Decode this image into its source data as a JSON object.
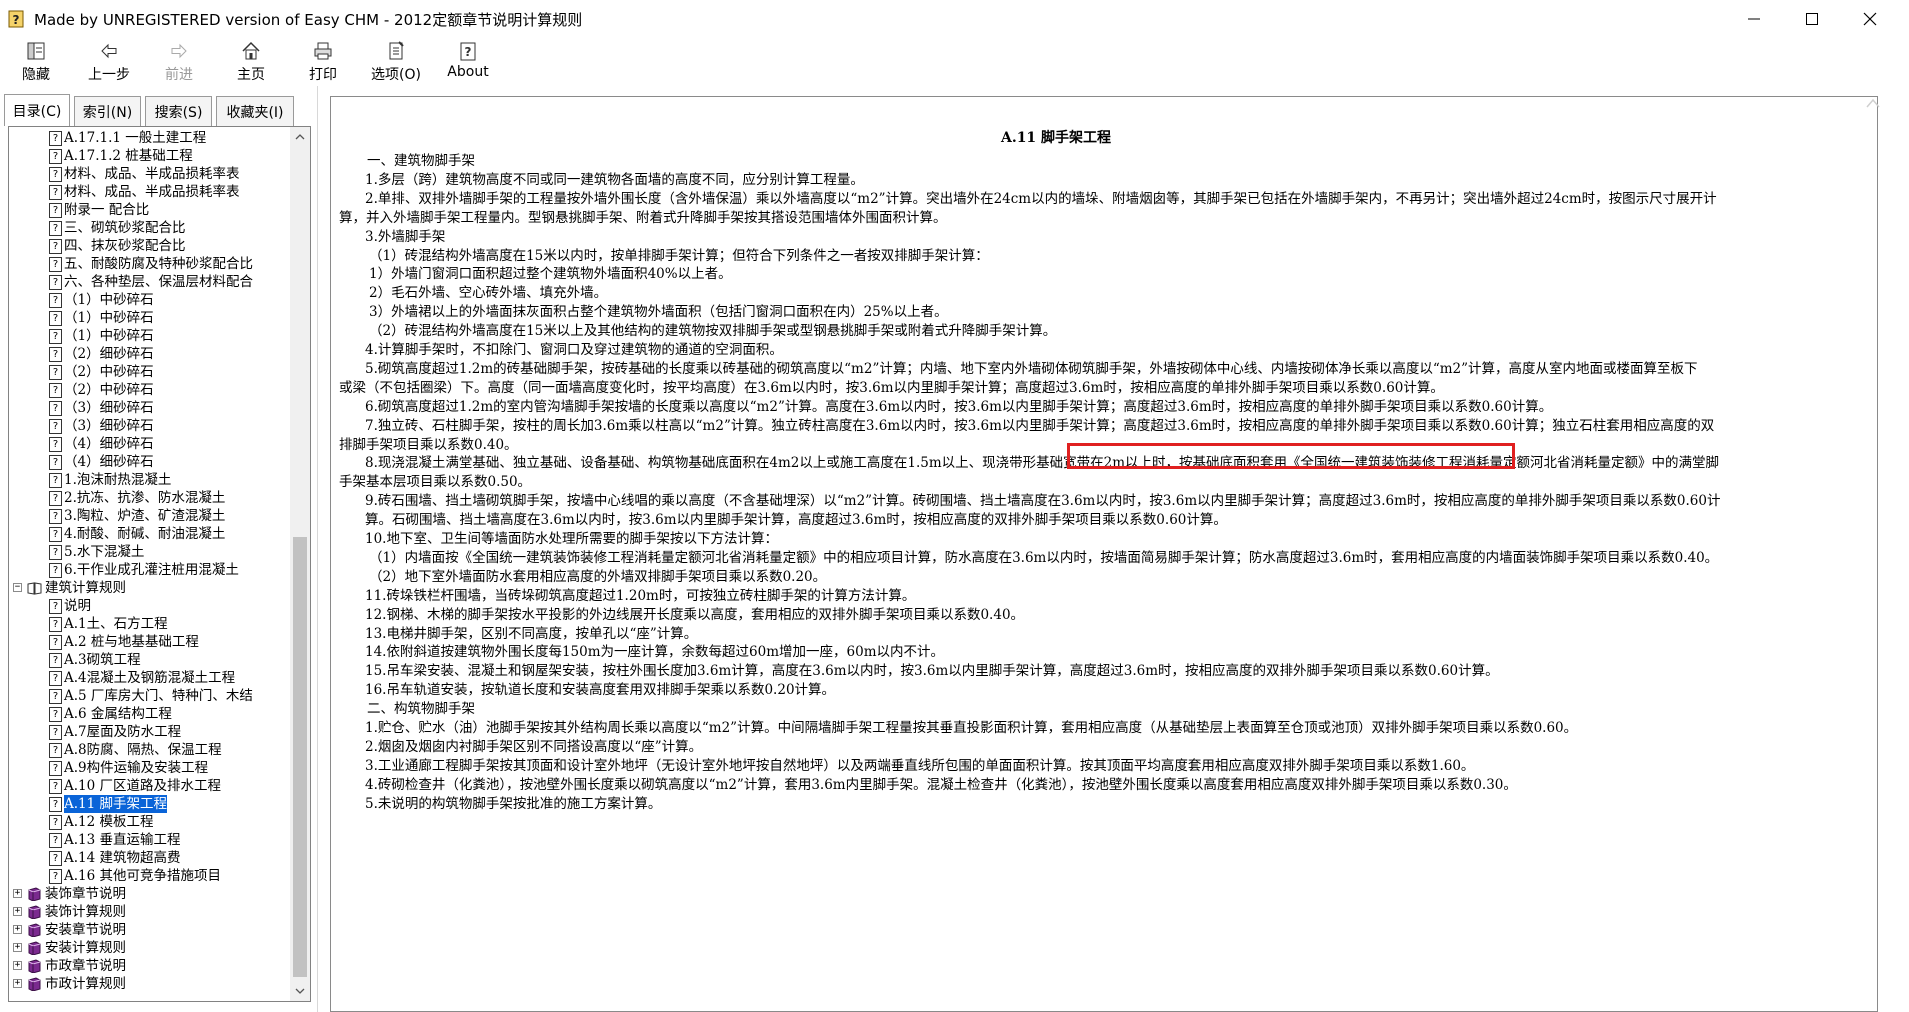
{
  "window": {
    "title": "Made by UNREGISTERED version of Easy CHM - 2012定额章节说明计算规则"
  },
  "toolbar": {
    "hide": "隐藏",
    "back": "上一步",
    "forward": "前进",
    "home": "主页",
    "print": "打印",
    "options": "选项(O)",
    "about": "About"
  },
  "nav_tabs": {
    "contents": "目录(C)",
    "index": "索引(N)",
    "search": "搜索(S)",
    "favorites": "收藏夹(I)"
  },
  "tree": [
    {
      "label": "A.17.1.1 一般土建工程",
      "type": "topic",
      "level": 3
    },
    {
      "label": "A.17.1.2 桩基础工程",
      "type": "topic",
      "level": 3
    },
    {
      "label": "材料、成品、半成品损耗率表",
      "type": "topic",
      "level": 3
    },
    {
      "label": "材料、成品、半成品损耗率表",
      "type": "topic",
      "level": 3
    },
    {
      "label": "附录一 配合比",
      "type": "topic",
      "level": 3
    },
    {
      "label": "三、砌筑砂浆配合比",
      "type": "topic",
      "level": 3
    },
    {
      "label": "四、抹灰砂浆配合比",
      "type": "topic",
      "level": 3
    },
    {
      "label": "五、耐酸防腐及特种砂浆配合比",
      "type": "topic",
      "level": 3
    },
    {
      "label": "六、各种垫层、保温层材料配合",
      "type": "topic",
      "level": 3
    },
    {
      "label": "（1）中砂碎石",
      "type": "topic",
      "level": 3
    },
    {
      "label": "（1）中砂碎石",
      "type": "topic",
      "level": 3
    },
    {
      "label": "（1）中砂碎石",
      "type": "topic",
      "level": 3
    },
    {
      "label": "（2）细砂碎石",
      "type": "topic",
      "level": 3
    },
    {
      "label": "（2）中砂碎石",
      "type": "topic",
      "level": 3
    },
    {
      "label": "（2）中砂碎石",
      "type": "topic",
      "level": 3
    },
    {
      "label": "（3）细砂碎石",
      "type": "topic",
      "level": 3
    },
    {
      "label": "（3）细砂碎石",
      "type": "topic",
      "level": 3
    },
    {
      "label": "（4）细砂碎石",
      "type": "topic",
      "level": 3
    },
    {
      "label": "（4）细砂碎石",
      "type": "topic",
      "level": 3
    },
    {
      "label": "1.泡沫耐热混凝土",
      "type": "topic",
      "level": 3
    },
    {
      "label": "2.抗冻、抗渗、防水混凝土",
      "type": "topic",
      "level": 3
    },
    {
      "label": "3.陶粒、炉渣、矿渣混凝土",
      "type": "topic",
      "level": 3
    },
    {
      "label": "4.耐酸、耐碱、耐油混凝土",
      "type": "topic",
      "level": 3
    },
    {
      "label": "5.水下混凝土",
      "type": "topic",
      "level": 3
    },
    {
      "label": "6.干作业成孔灌注桩用混凝土",
      "type": "topic",
      "level": 3
    },
    {
      "label": "建筑计算规则",
      "type": "book-open",
      "level": 1,
      "expander": "−"
    },
    {
      "label": "说明",
      "type": "topic",
      "level": 3
    },
    {
      "label": "A.1土、石方工程",
      "type": "topic",
      "level": 3
    },
    {
      "label": "A.2 桩与地基基础工程",
      "type": "topic",
      "level": 3
    },
    {
      "label": "A.3砌筑工程",
      "type": "topic",
      "level": 3
    },
    {
      "label": "A.4混凝土及钢筋混凝土工程",
      "type": "topic",
      "level": 3
    },
    {
      "label": "A.5 厂库房大门、特种门、木结",
      "type": "topic",
      "level": 3
    },
    {
      "label": "A.6 金属结构工程",
      "type": "topic",
      "level": 3
    },
    {
      "label": "A.7屋面及防水工程",
      "type": "topic",
      "level": 3
    },
    {
      "label": "A.8防腐、隔热、保温工程",
      "type": "topic",
      "level": 3
    },
    {
      "label": "A.9构件运输及安装工程",
      "type": "topic",
      "level": 3
    },
    {
      "label": "A.10 厂区道路及排水工程",
      "type": "topic",
      "level": 3
    },
    {
      "label": "A.11 脚手架工程",
      "type": "topic",
      "level": 3,
      "selected": true
    },
    {
      "label": "A.12 模板工程",
      "type": "topic",
      "level": 3
    },
    {
      "label": "A.13 垂直运输工程",
      "type": "topic",
      "level": 3
    },
    {
      "label": "A.14 建筑物超高费",
      "type": "topic",
      "level": 3
    },
    {
      "label": "A.16 其他可竞争措施项目",
      "type": "topic",
      "level": 3
    },
    {
      "label": "装饰章节说明",
      "type": "book",
      "level": 1,
      "expander": "+"
    },
    {
      "label": "装饰计算规则",
      "type": "book",
      "level": 1,
      "expander": "+"
    },
    {
      "label": "安装章节说明",
      "type": "book",
      "level": 1,
      "expander": "+"
    },
    {
      "label": "安装计算规则",
      "type": "book",
      "level": 1,
      "expander": "+"
    },
    {
      "label": "市政章节说明",
      "type": "book",
      "level": 1,
      "expander": "+"
    },
    {
      "label": "市政计算规则",
      "type": "book",
      "level": 1,
      "expander": "+"
    }
  ],
  "doc": {
    "title": "A.11 脚手架工程",
    "paragraphs": [
      {
        "text": "一、建筑物脚手架",
        "indent": 1
      },
      {
        "text": "1.多层（跨）建筑物高度不同或同一建筑物各面墙的高度不同，应分别计算工程量。",
        "indent": 2
      },
      {
        "text": "2.单排、双排外墙脚手架的工程量按外墙外围长度（含外墙保温）乘以外墙高度以“m2”计算。突出墙外在24cm以内的墙垛、附墙烟囱等，其脚手架已包括在外墙脚手架内，不再另计；突出墙外超过24cm时，按图示尺寸展开计",
        "indent": 2
      },
      {
        "text": "算，并入外墙脚手架工程量内。型钢悬挑脚手架、附着式升降脚手架按其搭设范围墙体外围面积计算。",
        "indent": 0
      },
      {
        "text": "3.外墙脚手架",
        "indent": 2
      },
      {
        "text": "（1）砖混结构外墙高度在15米以内时，按单排脚手架计算；但符合下列条件之一者按双排脚手架计算：",
        "indent": 3
      },
      {
        "text": "1）外墙门窗洞口面积超过整个建筑物外墙面积40%以上者。",
        "indent": 3
      },
      {
        "text": "2）毛石外墙、空心砖外墙、填充外墙。",
        "indent": 3
      },
      {
        "text": "3）外墙裙以上的外墙面抹灰面积占整个建筑物外墙面积（包括门窗洞口面积在内）25%以上者。",
        "indent": 3
      },
      {
        "text": "（2）砖混结构外墙高度在15米以上及其他结构的建筑物按双排脚手架或型钢悬挑脚手架或附着式升降脚手架计算。",
        "indent": 3
      },
      {
        "text": "4.计算脚手架时，不扣除门、窗洞口及穿过建筑物的通道的空洞面积。",
        "indent": 2
      },
      {
        "text": "5.砌筑高度超过1.2m的砖基础脚手架，按砖基础的长度乘以砖基础的砌筑高度以“m2”计算；内墙、地下室内外墙砌体砌筑脚手架，外墙按砌体中心线、内墙按砌体净长乘以高度以“m2”计算，高度从室内地面或楼面算至板下",
        "indent": 2
      },
      {
        "text": "或梁（不包括圈梁）下。高度（同一面墙高度变化时，按平均高度）在3.6m以内时，按3.6m以内里脚手架计算；高度超过3.6m时，按相应高度的单排外脚手架项目乘以系数0.60计算。",
        "indent": 0
      },
      {
        "text": "6.砌筑高度超过1.2m的室内管沟墙脚手架按墙的长度乘以高度以“m2”计算。高度在3.6m以内时，按3.6m以内里脚手架计算；高度超过3.6m时，按相应高度的单排外脚手架项目乘以系数0.60计算。",
        "indent": 2
      },
      {
        "text": "7.独立砖、石柱脚手架，按柱的周长加3.6m乘以柱高以“m2”计算。独立砖柱高度在3.6m以内时，按3.6m以内里脚手架计算；高度超过3.6m时，按相应高度的单排外脚手架项目乘以系数0.60计算；独立石柱套用相应高度的双",
        "indent": 2
      },
      {
        "text": "排脚手架项目乘以系数0.40。",
        "indent": 0
      },
      {
        "text": "8.现浇混凝土满堂基础、独立基础、设备基础、构筑物基础底面积在4m2以上或施工高度在1.5m以上、现浇带形基础宽带在2m以上时，按基础底面积套用《全国统一建筑装饰装修工程消耗量定额河北省消耗量定额》中的满堂脚",
        "indent": 2
      },
      {
        "text": "手架基本层项目乘以系数0.50。",
        "indent": 0
      },
      {
        "text": "9.砖石围墙、挡土墙砌筑脚手架，按墙中心线唱的乘以高度（不含基础埋深）以“m2”计算。砖砌围墙、挡土墙高度在3.6m以内时，按3.6m以内里脚手架计算；高度超过3.6m时，按相应高度的单排外脚手架项目乘以系数0.60计",
        "indent": 2
      },
      {
        "text": "算。石砌围墙、挡土墙高度在3.6m以内时，按3.6m以内里脚手架计算，高度超过3.6m时，按相应高度的双排外脚手架项目乘以系数0.60计算。",
        "indent": 2
      },
      {
        "text": "10.地下室、卫生间等墙面防水处理所需要的脚手架按以下方法计算：",
        "indent": 2
      },
      {
        "text": "（1）内墙面按《全国统一建筑装饰装修工程消耗量定额河北省消耗量定额》中的相应项目计算，防水高度在3.6m以内时，按墙面简易脚手架计算；防水高度超过3.6m时，套用相应高度的内墙面装饰脚手架项目乘以系数0.40。",
        "indent": 3
      },
      {
        "text": "（2）地下室外墙面防水套用相应高度的外墙双排脚手架项目乘以系数0.20。",
        "indent": 3
      },
      {
        "text": "11.砖垛铁栏杆围墙，当砖垛砌筑高度超过1.20m时，可按独立砖柱脚手架的计算方法计算。",
        "indent": 2
      },
      {
        "text": "12.钢梯、木梯的脚手架按水平投影的外边线展开长度乘以高度，套用相应的双排外脚手架项目乘以系数0.40。",
        "indent": 2
      },
      {
        "text": "13.电梯井脚手架，区别不同高度，按单孔以“座”计算。",
        "indent": 2
      },
      {
        "text": "14.依附斜道按建筑物外围长度每150m为一座计算，余数每超过60m增加一座，60m以内不计。",
        "indent": 2
      },
      {
        "text": "15.吊车梁安装、混凝土和钢屋架安装，按柱外围长度加3.6m计算，高度在3.6m以内时，按3.6m以内里脚手架计算，高度超过3.6m时，按相应高度的双排外脚手架项目乘以系数0.60计算。",
        "indent": 2
      },
      {
        "text": "16.吊车轨道安装，按轨道长度和安装高度套用双排脚手架乘以系数0.20计算。",
        "indent": 2
      },
      {
        "text": "二、构筑物脚手架",
        "indent": 1
      },
      {
        "text": "1.贮仓、贮水（油）池脚手架按其外结构周长乘以高度以“m2”计算。中间隔墙脚手架工程量按其垂直投影面积计算，套用相应高度（从基础垫层上表面算至仓顶或池顶）双排外脚手架项目乘以系数0.60。",
        "indent": 2
      },
      {
        "text": "2.烟囱及烟囱内衬脚手架区别不同搭设高度以“座”计算。",
        "indent": 2
      },
      {
        "text": "3.工业通廊工程脚手架按其顶面和设计室外地坪（无设计室外地坪按自然地坪）以及两端垂直线所包围的单面面积计算。按其顶面平均高度套用相应高度双排外脚手架项目乘以系数1.60。",
        "indent": 2
      },
      {
        "text": "4.砖砌检查井（化粪池），按池壁外围长度乘以砌筑高度以“m2”计算，套用3.6m内里脚手架。混凝土检查井（化粪池），按池壁外围长度乘以高度套用相应高度双排外脚手架项目乘以系数0.30。",
        "indent": 2
      },
      {
        "text": "5.未说明的构筑物脚手架按批准的施工方案计算。",
        "indent": 2
      }
    ]
  },
  "colors": {
    "selection": "#0a64d8",
    "highlight_box": "#e02020"
  }
}
